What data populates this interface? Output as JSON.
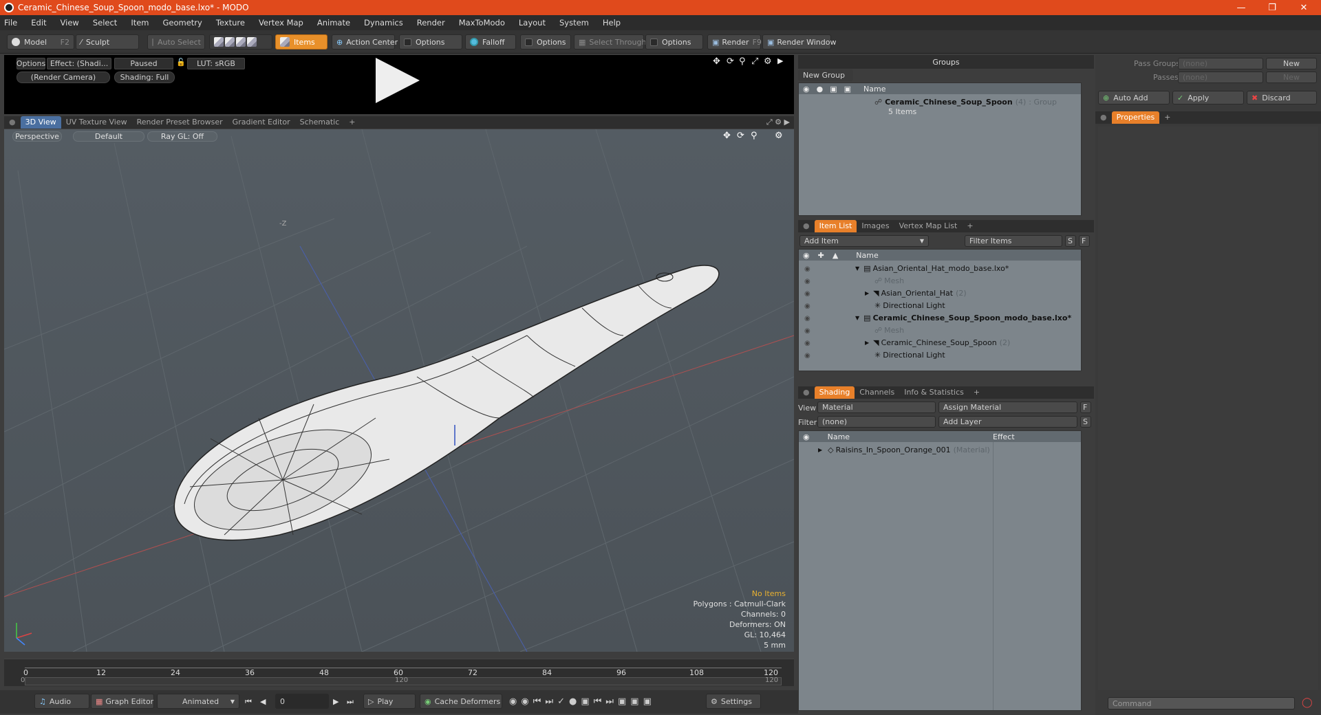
{
  "window": {
    "title": "Ceramic_Chinese_Soup_Spoon_modo_base.lxo* - MODO"
  },
  "menu": [
    "File",
    "Edit",
    "View",
    "Select",
    "Item",
    "Geometry",
    "Texture",
    "Vertex Map",
    "Animate",
    "Dynamics",
    "Render",
    "MaxToModo",
    "Layout",
    "System",
    "Help"
  ],
  "toolbar": {
    "model": "Model",
    "model_key": "F2",
    "sculpt": "Sculpt",
    "auto_select": "Auto Select",
    "items": "Items",
    "action_center": "Action Center",
    "options": "Options",
    "falloff": "Falloff",
    "select_through": "Select Through",
    "render": "Render",
    "render_key": "F9",
    "render_window": "Render Window"
  },
  "preview": {
    "options": "Options",
    "effect": "Effect: (Shadi...",
    "paused": "Paused",
    "lut": "LUT: sRGB",
    "camera": "(Render Camera)",
    "shading": "Shading: Full"
  },
  "viewport_tabs": [
    "3D View",
    "UV Texture View",
    "Render Preset Browser",
    "Gradient Editor",
    "Schematic",
    "+"
  ],
  "viewport": {
    "perspective": "Perspective",
    "default": "Default",
    "raygl": "Ray GL: Off",
    "axis_label": "-Z"
  },
  "hud": {
    "no_items": "No Items",
    "polygons": "Polygons : Catmull-Clark",
    "channels": "Channels: 0",
    "deformers": "Deformers: ON",
    "gl": "GL: 10,464",
    "unit": "5 mm"
  },
  "timeline": {
    "ticks": [
      "0",
      "12",
      "24",
      "36",
      "48",
      "60",
      "72",
      "84",
      "96",
      "108",
      "120"
    ],
    "start": "0",
    "mid": "120",
    "end": "120"
  },
  "bottombar": {
    "audio": "Audio",
    "graph_editor": "Graph Editor",
    "animated": "Animated",
    "frame": "0",
    "play": "Play",
    "cache": "Cache Deformers",
    "settings": "Settings"
  },
  "groups": {
    "title": "Groups",
    "new_group": "New Group",
    "col_name": "Name",
    "item_name": "Ceramic_Chinese_Soup_Spoon",
    "item_count": "(4)",
    "item_type": ": Group",
    "item_sub": "5 Items"
  },
  "itemlist": {
    "tabs": [
      "Item List",
      "Images",
      "Vertex Map List",
      "+"
    ],
    "add_item": "Add Item",
    "filter": "Filter Items",
    "s": "S",
    "f": "F",
    "col_name": "Name",
    "rows": [
      {
        "label": "Asian_Oriental_Hat_modo_base.lxo*",
        "extra": "",
        "bold": false
      },
      {
        "label": "Mesh",
        "extra": "",
        "bold": false,
        "gray": true
      },
      {
        "label": "Asian_Oriental_Hat",
        "extra": "(2)",
        "bold": false
      },
      {
        "label": "Directional Light",
        "extra": "",
        "bold": false
      },
      {
        "label": "Ceramic_Chinese_Soup_Spoon_modo_base.lxo*",
        "extra": "",
        "bold": true
      },
      {
        "label": "Mesh",
        "extra": "",
        "bold": false,
        "gray": true
      },
      {
        "label": "Ceramic_Chinese_Soup_Spoon",
        "extra": "(2)",
        "bold": false
      },
      {
        "label": "Directional Light",
        "extra": "",
        "bold": false
      }
    ]
  },
  "shading": {
    "tabs": [
      "Shading",
      "Channels",
      "Info & Statistics",
      "+"
    ],
    "view_label": "View",
    "view_value": "Material",
    "assign": "Assign Material",
    "filter_label": "Filter",
    "filter_value": "(none)",
    "add_layer": "Add Layer",
    "f": "F",
    "s": "S",
    "col_name": "Name",
    "col_effect": "Effect",
    "row_label": "Raisins_In_Spoon_Orange_001",
    "row_type": "(Material)"
  },
  "passes": {
    "pass_groups": "Pass Groups",
    "pass_groups_val": "(none)",
    "passes": "Passes",
    "passes_val": "(none)",
    "new": "New",
    "new2": "New",
    "auto_add": "Auto Add",
    "apply": "Apply",
    "discard": "Discard",
    "properties": "Properties",
    "command": "Command"
  },
  "colors": {
    "title_bar": "#e04a1c",
    "accent": "#e8802a"
  }
}
